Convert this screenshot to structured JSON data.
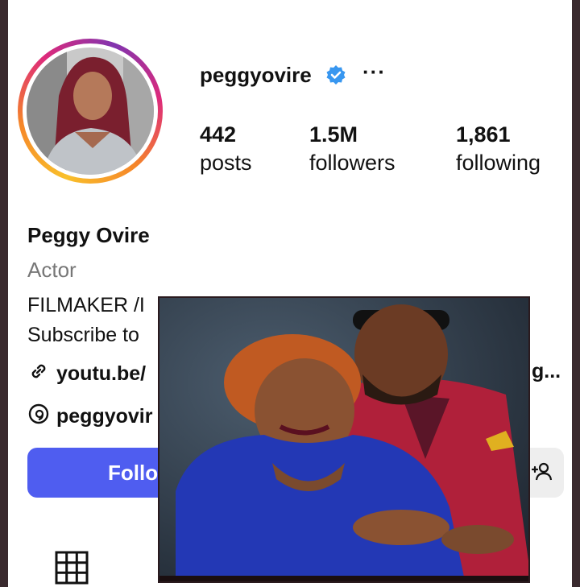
{
  "profile": {
    "username": "peggyovire",
    "more_label": "···",
    "icons": {
      "verified": "verified-badge-icon",
      "more": "more-icon"
    }
  },
  "stats": [
    {
      "value": "442",
      "label": "posts"
    },
    {
      "value": "1.5M",
      "label": "followers"
    },
    {
      "value": "1,861",
      "label": "following"
    }
  ],
  "bio": {
    "name": "Peggy Ovire",
    "category": "Actor",
    "line1": "FILMAKER /I",
    "line2": "Subscribe to",
    "link_visible": "youtu.be/",
    "link_tail": "g...",
    "threads": "peggyovir"
  },
  "actions": {
    "follow_label": "Follo"
  },
  "colors": {
    "follow_button": "#4f5df0",
    "verified": "#3897f0",
    "category_text": "#777777"
  }
}
